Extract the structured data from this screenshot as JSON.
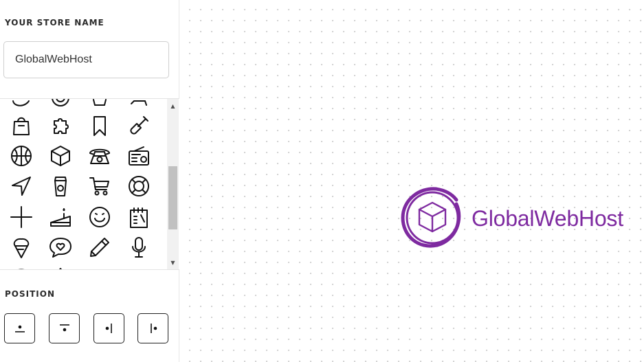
{
  "store": {
    "label": "YOUR STORE NAME",
    "value": "GlobalWebHost"
  },
  "icons": {
    "rows": [
      [
        "bag-icon",
        "puzzle-icon",
        "bookmark-icon",
        "shovel-icon"
      ],
      [
        "basketball-icon",
        "cube-icon",
        "telephone-icon",
        "radio-icon"
      ],
      [
        "navigation-arrow-icon",
        "coffee-cup-icon",
        "shopping-cart-icon",
        "lifebuoy-icon"
      ],
      [
        "plus-icon",
        "cake-icon",
        "smiley-icon",
        "notebook-icon"
      ],
      [
        "ice-cream-icon",
        "heart-bubble-icon",
        "pencil-icon",
        "microphone-icon"
      ]
    ]
  },
  "position": {
    "label": "POSITION",
    "options": [
      "center",
      "top",
      "left",
      "right"
    ]
  },
  "logo": {
    "text": "GlobalWebHost",
    "color": "#7e2aa0",
    "icon": "cube-icon"
  }
}
